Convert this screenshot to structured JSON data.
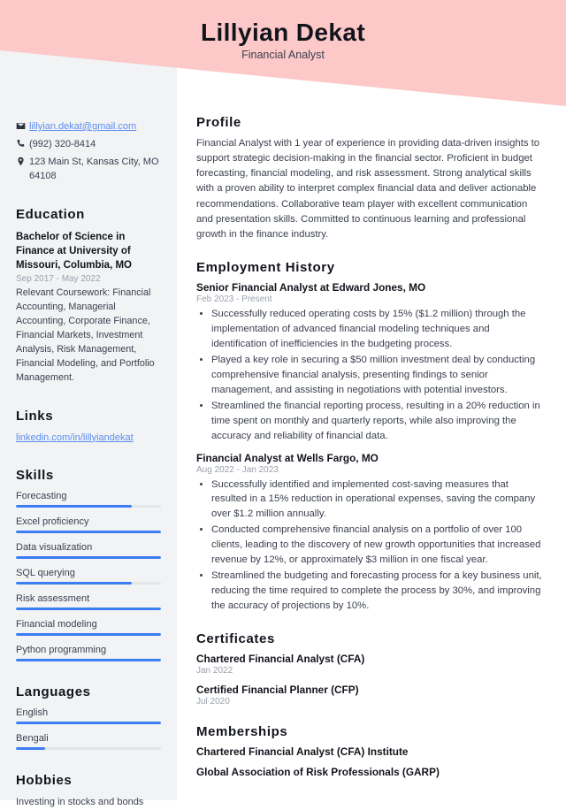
{
  "theme": {
    "banner_color": "#fcc8c8",
    "sidebar_color": "#f2f3f5",
    "accent_color": "#3b7ef3",
    "link_color": "#5b8def",
    "heading_color": "#12141c",
    "body_color": "#3a3f4d",
    "muted_color": "#9aa0ab"
  },
  "header": {
    "name": "Lillyian Dekat",
    "job_title": "Financial Analyst"
  },
  "contact": {
    "email": "lillyian.dekat@gmail.com",
    "phone": "(992) 320-8414",
    "address": "123 Main St, Kansas City, MO 64108",
    "icons": {
      "email": "envelope-icon",
      "phone": "phone-icon",
      "address": "location-pin-icon"
    }
  },
  "education": {
    "heading": "Education",
    "items": [
      {
        "title": "Bachelor of Science in Finance at University of Missouri, Columbia, MO",
        "date": "Sep 2017 - May 2022",
        "description": "Relevant Coursework: Financial Accounting, Managerial Accounting, Corporate Finance, Financial Markets, Investment Analysis, Risk Management, Financial Modeling, and Portfolio Management."
      }
    ]
  },
  "links": {
    "heading": "Links",
    "items": [
      {
        "label": "linkedin.com/in/lillyiandekat"
      }
    ]
  },
  "skills": {
    "heading": "Skills",
    "items": [
      {
        "label": "Forecasting",
        "level": 80
      },
      {
        "label": "Excel proficiency",
        "level": 100
      },
      {
        "label": "Data visualization",
        "level": 100
      },
      {
        "label": "SQL querying",
        "level": 80
      },
      {
        "label": "Risk assessment",
        "level": 100
      },
      {
        "label": "Financial modeling",
        "level": 100
      },
      {
        "label": "Python programming",
        "level": 100
      }
    ]
  },
  "languages": {
    "heading": "Languages",
    "items": [
      {
        "label": "English",
        "level": 100
      },
      {
        "label": "Bengali",
        "level": 20
      }
    ]
  },
  "hobbies": {
    "heading": "Hobbies",
    "text": "Investing in stocks and bonds"
  },
  "profile": {
    "heading": "Profile",
    "text": "Financial Analyst with 1 year of experience in providing data-driven insights to support strategic decision-making in the financial sector. Proficient in budget forecasting, financial modeling, and risk assessment. Strong analytical skills with a proven ability to interpret complex financial data and deliver actionable recommendations. Collaborative team player with excellent communication and presentation skills. Committed to continuous learning and professional growth in the finance industry."
  },
  "employment": {
    "heading": "Employment History",
    "jobs": [
      {
        "title": "Senior Financial Analyst at Edward Jones, MO",
        "date": "Feb 2023 - Present",
        "bullets": [
          "Successfully reduced operating costs by 15% ($1.2 million) through the implementation of advanced financial modeling techniques and identification of inefficiencies in the budgeting process.",
          "Played a key role in securing a $50 million investment deal by conducting comprehensive financial analysis, presenting findings to senior management, and assisting in negotiations with potential investors.",
          "Streamlined the financial reporting process, resulting in a 20% reduction in time spent on monthly and quarterly reports, while also improving the accuracy and reliability of financial data."
        ]
      },
      {
        "title": "Financial Analyst at Wells Fargo, MO",
        "date": "Aug 2022 - Jan 2023",
        "bullets": [
          "Successfully identified and implemented cost-saving measures that resulted in a 15% reduction in operational expenses, saving the company over $1.2 million annually.",
          "Conducted comprehensive financial analysis on a portfolio of over 100 clients, leading to the discovery of new growth opportunities that increased revenue by 12%, or approximately $3 million in one fiscal year.",
          "Streamlined the budgeting and forecasting process for a key business unit, reducing the time required to complete the process by 30%, and improving the accuracy of projections by 10%."
        ]
      }
    ]
  },
  "certificates": {
    "heading": "Certificates",
    "items": [
      {
        "title": "Chartered Financial Analyst (CFA)",
        "date": "Jan 2022"
      },
      {
        "title": "Certified Financial Planner (CFP)",
        "date": "Jul 2020"
      }
    ]
  },
  "memberships": {
    "heading": "Memberships",
    "items": [
      {
        "title": "Chartered Financial Analyst (CFA) Institute"
      },
      {
        "title": "Global Association of Risk Professionals (GARP)"
      }
    ]
  }
}
